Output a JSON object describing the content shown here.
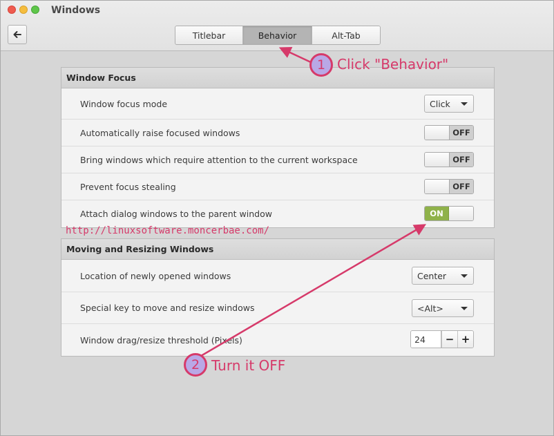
{
  "window": {
    "title": "Windows"
  },
  "tabs": [
    {
      "label": "Titlebar",
      "active": false
    },
    {
      "label": "Behavior",
      "active": true
    },
    {
      "label": "Alt-Tab",
      "active": false
    }
  ],
  "icons": {
    "back": "back-arrow-icon"
  },
  "focus_section": {
    "title": "Window Focus",
    "rows": [
      {
        "label": "Window focus mode",
        "control": "combo",
        "value": "Click"
      },
      {
        "label": "Automatically raise focused windows",
        "control": "switch",
        "value": "OFF"
      },
      {
        "label": "Bring windows which require attention to the current workspace",
        "control": "switch",
        "value": "OFF"
      },
      {
        "label": "Prevent focus stealing",
        "control": "switch",
        "value": "OFF"
      },
      {
        "label": "Attach dialog windows to the parent window",
        "control": "switch",
        "value": "ON"
      }
    ]
  },
  "moving_section": {
    "title": "Moving and Resizing Windows",
    "rows": [
      {
        "label": "Location of newly opened windows",
        "control": "combo",
        "value": "Center"
      },
      {
        "label": "Special key to move and resize windows",
        "control": "combo",
        "value": "<Alt>"
      },
      {
        "label": "Window drag/resize threshold (Pixels)",
        "control": "spin",
        "value": "24",
        "minus": "−",
        "plus": "+"
      }
    ]
  },
  "annotations": {
    "watermark": "http://linuxsoftware.moncerbae.com/",
    "callout1": {
      "number": "1",
      "text": "Click \"Behavior\""
    },
    "callout2": {
      "number": "2",
      "text": "Turn it OFF"
    },
    "color": "#d63a6a"
  },
  "colors": {
    "switch_on": "#8fb24a",
    "switch_off": "#cfcfcf",
    "annotation": "#d63a6a"
  }
}
